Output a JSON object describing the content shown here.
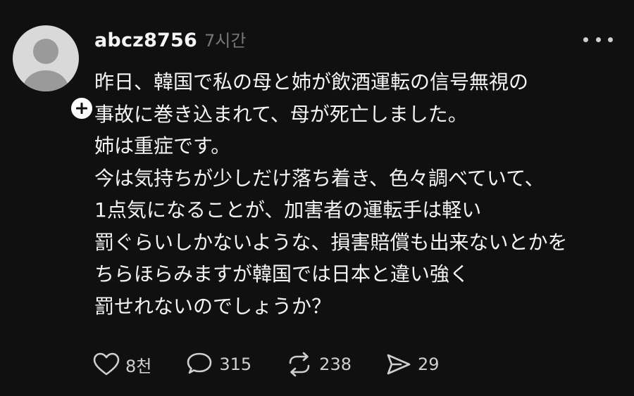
{
  "post": {
    "username": "abcz8756",
    "timestamp": "7시간",
    "lines": [
      "昨日、韓国で私の母と姉が飲酒運転の信号無視の",
      "事故に巻き込まれて、母が死亡しました。",
      "姉は重症です。",
      "今は気持ちが少しだけ落ち着き、色々調べていて、",
      "1点気になることが、加害者の運転手は軽い",
      "罰ぐらいしかないような、損害賠償も出来ないとかを",
      "ちらほらみますが韓国では日本と違い強く",
      "罰せれないのでしょうか？"
    ]
  },
  "actions": {
    "likes": "8천",
    "replies": "315",
    "reposts": "238",
    "shares": "29"
  },
  "icons": {
    "like": "heart-icon",
    "reply": "speech-bubble-icon",
    "repost": "repost-arrows-icon",
    "share": "send-icon",
    "more": "more-dots-icon",
    "follow": "plus-icon"
  },
  "colors": {
    "background": "#101010",
    "text": "#f3f5f7",
    "muted": "#777777"
  }
}
